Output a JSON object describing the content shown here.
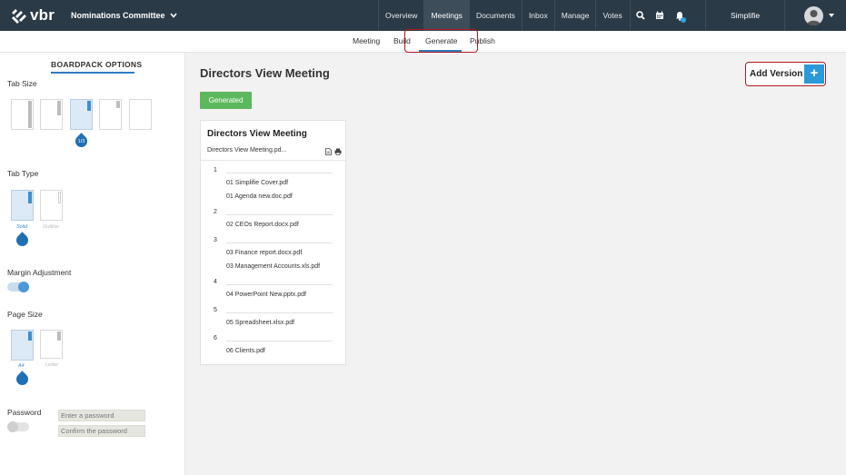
{
  "app": {
    "logo_text": "vbr",
    "committee": "Nominations Committee"
  },
  "nav": [
    {
      "label": "Overview",
      "active": false
    },
    {
      "label": "Meetings",
      "active": true
    },
    {
      "label": "Documents",
      "active": false
    },
    {
      "label": "Inbox",
      "active": false
    },
    {
      "label": "Manage",
      "active": false
    },
    {
      "label": "Votes",
      "active": false
    }
  ],
  "tools": {
    "search_icon": "search-icon",
    "calendar_icon": "calendar-icon",
    "bell_icon": "bell-icon"
  },
  "user": {
    "name": "Simplifie"
  },
  "subnav": [
    {
      "label": "Meeting",
      "active": false
    },
    {
      "label": "Build",
      "active": false
    },
    {
      "label": "Generate",
      "active": true
    },
    {
      "label": "Publish",
      "active": false
    }
  ],
  "sidebar": {
    "title": "BOARDPACK OPTIONS",
    "tab_size": {
      "label": "Tab Size",
      "selected_label": "1/3"
    },
    "tab_type": {
      "label": "Tab Type",
      "options": [
        "Solid",
        "Outline"
      ],
      "selected": "Solid"
    },
    "margin": {
      "label": "Margin Adjustment",
      "enabled": true
    },
    "page_size": {
      "label": "Page Size",
      "options": [
        "A4",
        "Letter"
      ],
      "selected": "A4"
    },
    "password": {
      "label": "Password",
      "enabled": false,
      "placeholder": "Enter a password",
      "confirm_placeholder": "Confirm the password"
    }
  },
  "main": {
    "title": "Directors View Meeting",
    "status": "Generated",
    "add_version_label": "Add Version",
    "add_version_icon": "+"
  },
  "card": {
    "title": "Directors View Meeting",
    "file": "Directors View Meeting.pd...",
    "sections": [
      {
        "number": "1",
        "docs": [
          "01 Simplifie Cover.pdf",
          "01 Agenda new.doc.pdf"
        ]
      },
      {
        "number": "2",
        "docs": [
          "02 CEOs Report.docx.pdf"
        ]
      },
      {
        "number": "3",
        "docs": [
          "03 Finance report.docx.pdf",
          "03 Management Accounts.xls.pdf"
        ]
      },
      {
        "number": "4",
        "docs": [
          "04 PowerPoint New.pptx.pdf"
        ]
      },
      {
        "number": "5",
        "docs": [
          "05 Spreadsheet.xlsx.pdf"
        ]
      },
      {
        "number": "6",
        "docs": [
          "06 Clients.pdf"
        ]
      }
    ]
  },
  "colors": {
    "topbar": "#2b3a47",
    "accent": "#2e7dc0",
    "success": "#5cb85c",
    "highlight": "#b0191e"
  }
}
